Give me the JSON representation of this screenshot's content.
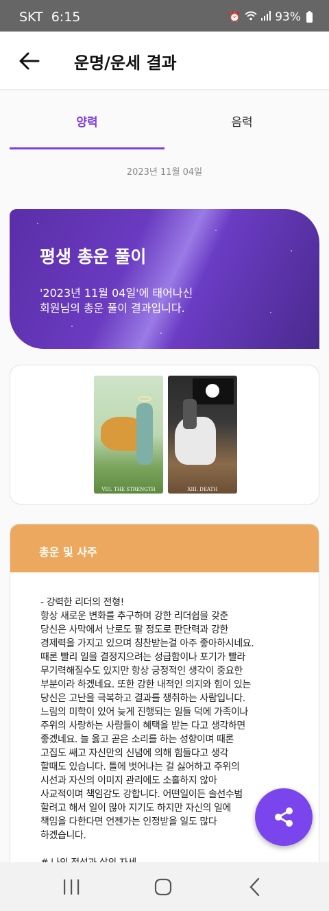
{
  "statusbar": {
    "carrier": "SKT",
    "time": "6:15",
    "battery": "93%",
    "icons": [
      "alarm-icon",
      "wifi-icon",
      "signal-icon",
      "battery-icon"
    ]
  },
  "appbar": {
    "title": "운명/운세 결과",
    "back_icon": "back-arrow-icon"
  },
  "tabs": [
    {
      "label": "양력",
      "selected": true
    },
    {
      "label": "음력",
      "selected": false
    }
  ],
  "date": "2023년 11월 04일",
  "banner": {
    "title": "평생 총운 풀이",
    "text_line1": "'2023년 11월 04일'에 태어나신",
    "text_line2": "회원님의 총운 풀이 결과입니다."
  },
  "cards": [
    {
      "caption": "VIII. THE STRENGTH",
      "icon": "strength-tarot-card"
    },
    {
      "caption": "XIII. DEATH",
      "icon": "death-tarot-card"
    }
  ],
  "section": {
    "title": "총운 및 사주",
    "body": " - 강력한 리더의 전형!\n항상 새로운 변화를 추구하며 강한 리더쉽을 갖춘\n당신은 사막에서 난로도 팔 정도로 판단력과 강한\n경제력을 가지고 있으며 칭찬받는걸 아주 좋아하시네요.\n때론 빨리 일을 결정지으려는 성급함이나 포기가 빨라\n무기력해질수도 있지만 항상 긍정적인 생각이 중요한\n부분이라 하겠네요. 또한 강한 내적인 의지와 힘이 있는\n당신은 고난을 극복하고 결과를 쟁취하는 사람입니다.\n느림의 미학이 있어 늦게 진행되는 일들 덕에 가족이나\n주위의 사랑하는 사람들이 혜택을 받는 다고 생각하면\n좋겠네요. 늘 옳고 곧은 소리를 하는 성향이며 때론\n고집도 쌔고 자신만의 신념에 의해 힘들다고 생각\n할때도 있습니다. 틀에 벗어나는 걸 싫어하고 주위의\n시선과 자신의 이미지 관리에도 소홀하지 않아\n사교적이며 책임감도 강합니다. 어떤일이든 솔선수범\n할려고 해서 일이 많아 지기도 하지만 자신의 일에\n책임을 다한다면 언젠가는 인정받을 일도 많다\n하겠습니다.\n\n# 나의 적성과 삶의 자세"
  },
  "fab": {
    "icon": "share-icon"
  },
  "navbar": {
    "items": [
      "recent-apps-icon",
      "home-icon",
      "back-icon"
    ]
  }
}
